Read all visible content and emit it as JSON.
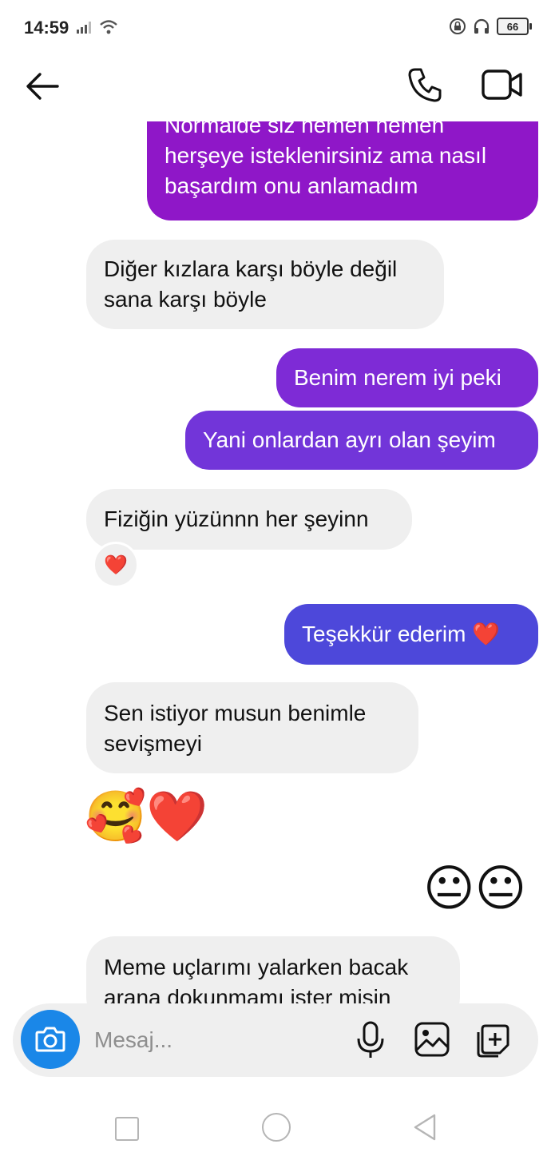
{
  "status_bar": {
    "time": "14:59",
    "battery": "66"
  },
  "header": {
    "back_icon": "arrow-left-icon",
    "call_icon": "phone-icon",
    "video_icon": "video-camera-icon"
  },
  "messages": [
    {
      "side": "out",
      "text": "Normalde siz hemen hemen\nherşeye isteklenirsiniz ama nasıl\nbaşardım onu anlamadım",
      "color": "#8f17c8"
    },
    {
      "side": "in",
      "text": "Diğer kızlara karşı böyle değil\nsana karşı böyle"
    },
    {
      "side": "out",
      "text": "Benim nerem iyi peki",
      "color": "#7e2bd6"
    },
    {
      "side": "out",
      "text": "Yani onlardan ayrı olan şeyim",
      "color": "#7235d9"
    },
    {
      "side": "in",
      "text": "Fiziğin yüzünnn her şeyinn",
      "reaction": "❤️"
    },
    {
      "side": "out",
      "text": "Teşekkür ederim ❤️",
      "color": "#4d48da"
    },
    {
      "side": "in",
      "text": "Sen istiyor musun benimle\nsevişmeyi"
    },
    {
      "side": "in",
      "emoji": "🥰❤️"
    },
    {
      "side": "out",
      "emoji": "😐😐"
    },
    {
      "side": "in",
      "text": "Meme uçlarımı yalarken bacak\narana dokunmamı ister misin"
    }
  ],
  "composer": {
    "placeholder": "Mesaj...",
    "camera_icon": "camera-icon",
    "mic_icon": "microphone-icon",
    "gallery_icon": "image-icon",
    "sticker_icon": "sticker-add-icon",
    "accent": "#1a87e8"
  },
  "nav": {
    "recents_icon": "square-icon",
    "home_icon": "circle-icon",
    "back_icon": "triangle-back-icon"
  }
}
